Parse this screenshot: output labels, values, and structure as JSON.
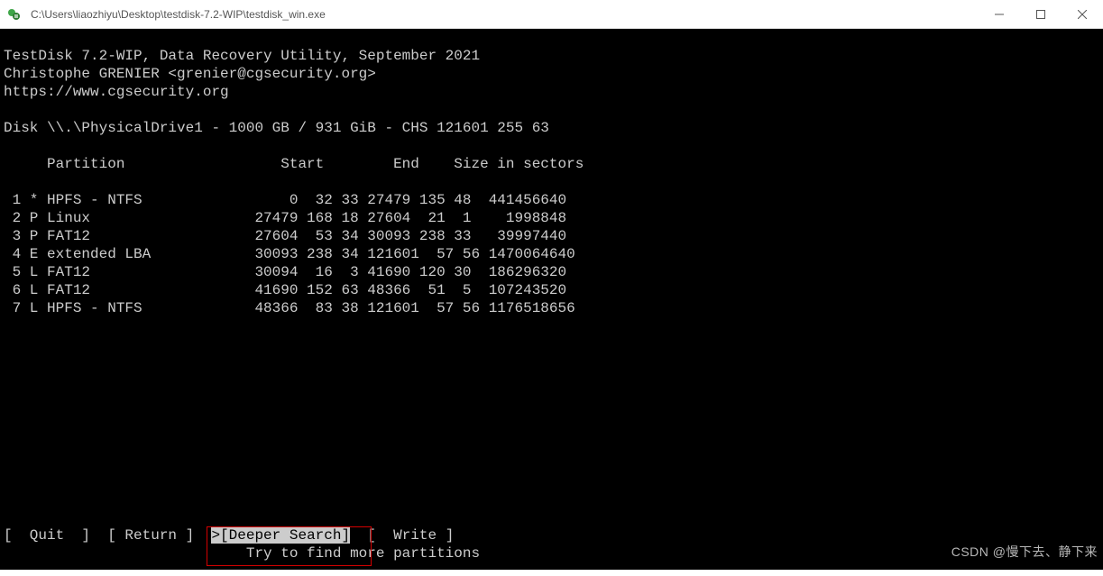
{
  "window": {
    "title": "C:\\Users\\liaozhiyu\\Desktop\\testdisk-7.2-WIP\\testdisk_win.exe"
  },
  "header": {
    "line1": "TestDisk 7.2-WIP, Data Recovery Utility, September 2021",
    "line2": "Christophe GRENIER <grenier@cgsecurity.org>",
    "line3": "https://www.cgsecurity.org"
  },
  "disk_line": "Disk \\\\.\\PhysicalDrive1 - 1000 GB / 931 GiB - CHS 121601 255 63",
  "table_header": "     Partition                  Start        End    Size in sectors",
  "partitions": [
    " 1 * HPFS - NTFS                 0  32 33 27479 135 48  441456640",
    " 2 P Linux                   27479 168 18 27604  21  1    1998848",
    " 3 P FAT12                   27604  53 34 30093 238 33   39997440",
    " 4 E extended LBA            30093 238 34 121601  57 56 1470064640",
    " 5 L FAT12                   30094  16  3 41690 120 30  186296320",
    " 6 L FAT12                   41690 152 63 48366  51  5  107243520",
    " 7 L HPFS - NTFS             48366  83 38 121601  57 56 1176518656"
  ],
  "menu": {
    "quit": "[  Quit  ]",
    "return": "[ Return ]",
    "deeper_prefix": ">",
    "deeper": "[Deeper Search]",
    "write": "[  Write ]",
    "spacer": "  "
  },
  "hint": "                            Try to find more partitions",
  "watermark": "CSDN @慢下去、静下来"
}
